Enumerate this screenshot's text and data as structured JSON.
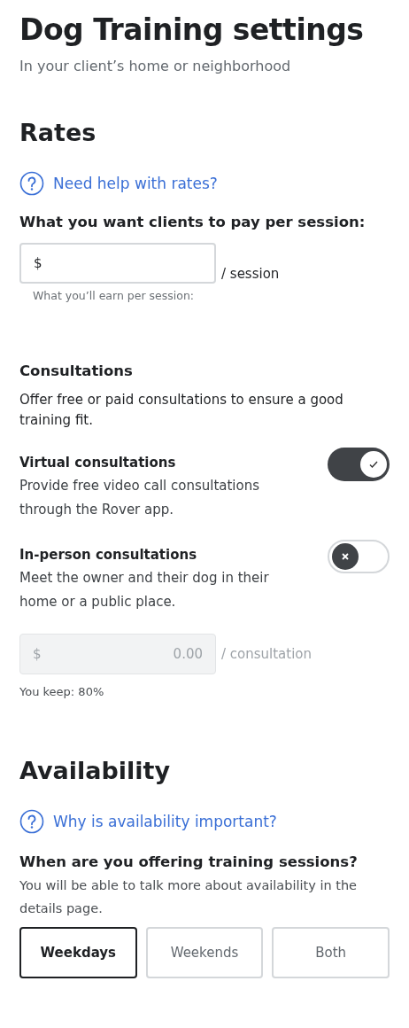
{
  "title": "Dog Training settings",
  "subtitle": "In your client’s home or neighborhood",
  "rates": {
    "heading": "Rates",
    "help_link": "Need help with rates?",
    "question": "What you want clients to pay per session:",
    "price_field": {
      "prefix": "$",
      "unit": "/ session",
      "disabled": false
    },
    "hint": "What you’ll earn per session:"
  },
  "consultations": {
    "heading": "Consultations",
    "description": "Offer free or paid consultations to ensure a good training fit.",
    "options": [
      {
        "title": "Virtual consultations",
        "description": "Provide free video call consultations through the Rover app.",
        "on": true
      },
      {
        "title": "In-person consultations",
        "description": "Meet the owner and their dog in their home or a public place.",
        "on": false
      }
    ],
    "fee_field": {
      "prefix": "$",
      "value": "0.00",
      "unit": "/ consultation",
      "disabled": true
    },
    "keep_note": "You keep: 80%"
  },
  "availability": {
    "heading": "Availability",
    "help_link": "Why is availability important?",
    "question": "When are you offering training sessions?",
    "description": "You will be able to talk more about availability in the details page.",
    "options": [
      {
        "label": "Weekdays",
        "selected": true
      },
      {
        "label": "Weekends",
        "selected": false
      },
      {
        "label": "Both",
        "selected": false
      }
    ]
  }
}
